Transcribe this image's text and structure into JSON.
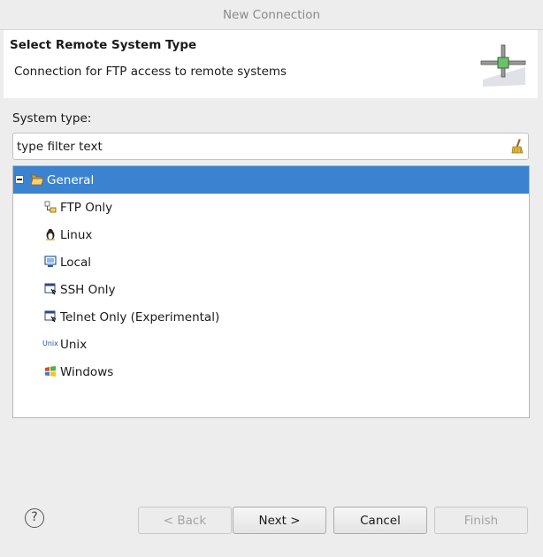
{
  "window": {
    "title": "New Connection"
  },
  "header": {
    "title": "Select Remote System Type",
    "description": "Connection for FTP access to remote systems"
  },
  "system_type": {
    "label": "System type:",
    "filter_value": "type filter text"
  },
  "tree": {
    "root": {
      "label": "General",
      "icon": "folder-open-icon",
      "expanded": true,
      "selected": true
    },
    "children": [
      {
        "label": "FTP Only",
        "icon": "ftp-icon"
      },
      {
        "label": "Linux",
        "icon": "linux-penguin-icon"
      },
      {
        "label": "Local",
        "icon": "local-computer-icon"
      },
      {
        "label": "SSH Only",
        "icon": "ssh-terminal-icon"
      },
      {
        "label": "Telnet Only (Experimental)",
        "icon": "telnet-terminal-icon"
      },
      {
        "label": "Unix",
        "icon": "unix-icon",
        "icon_text": "Unix"
      },
      {
        "label": "Windows",
        "icon": "windows-icon"
      }
    ]
  },
  "buttons": {
    "help": "?",
    "back": "< Back",
    "next": "Next >",
    "cancel": "Cancel",
    "finish": "Finish"
  },
  "colors": {
    "selection": "#3b83d1",
    "background": "#ededed"
  }
}
